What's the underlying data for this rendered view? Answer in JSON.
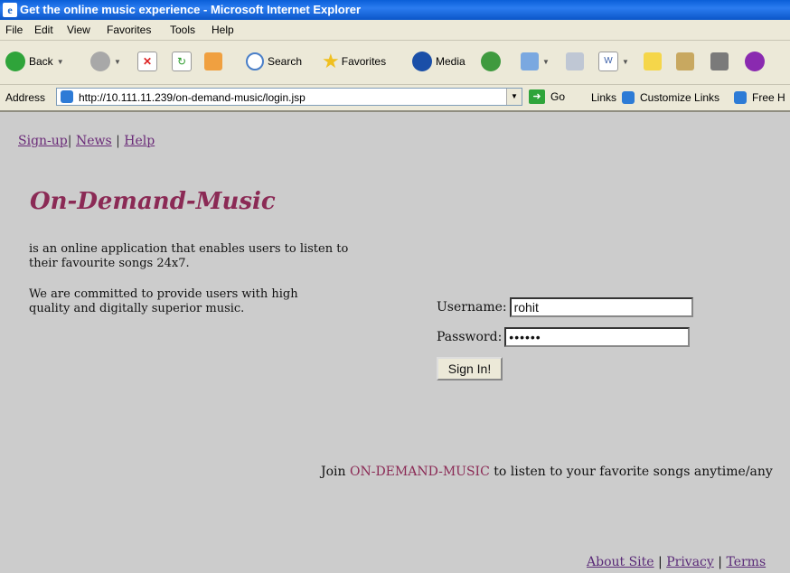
{
  "window": {
    "title": "Get the online music experience - Microsoft Internet Explorer"
  },
  "menu": [
    "File",
    "Edit",
    "View",
    "Favorites",
    "Tools",
    "Help"
  ],
  "toolbar": {
    "back": "Back",
    "search": "Search",
    "favorites": "Favorites",
    "media": "Media"
  },
  "address": {
    "label": "Address",
    "url": "http://10.111.11.239/on-demand-music/login.jsp",
    "go": "Go",
    "links": "Links",
    "customize": "Customize Links",
    "free": "Free H"
  },
  "nav": {
    "signup": "Sign-up",
    "sep1": "|",
    "news": "News",
    "sep2": "|",
    "help": "Help"
  },
  "brand": "On-Demand-Music",
  "desc1": "is an online application that enables users to listen to their favourite songs 24x7.",
  "desc2": "We are committed to provide users with high quality and digitally superior music.",
  "login": {
    "username_label": "Username:",
    "username_value": "rohit",
    "password_label": "Password:",
    "password_value": "••••••",
    "submit": "Sign In!"
  },
  "join": {
    "prefix": "Join",
    "name": "ON-DEMAND-MUSIC",
    "suffix": "to listen to your favorite songs anytime/any"
  },
  "footer": {
    "about": "About Site",
    "sep1": "|",
    "privacy": "Privacy",
    "sep2": "|",
    "terms": "Terms"
  }
}
